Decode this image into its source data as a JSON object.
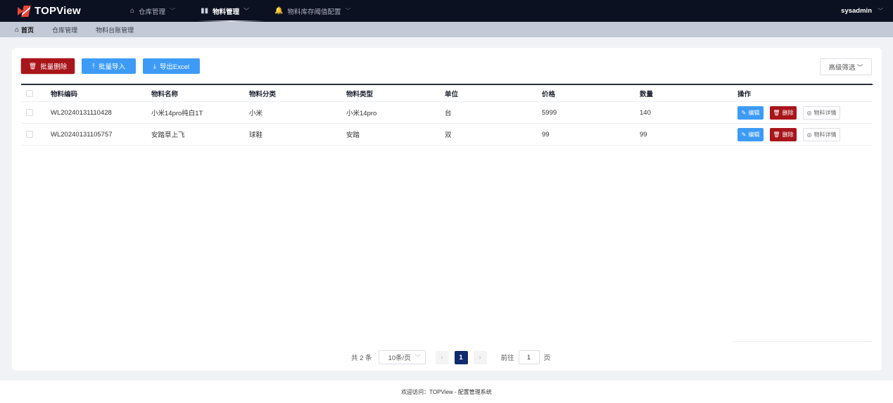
{
  "app": {
    "brand": "TOPView"
  },
  "nav": [
    {
      "label": "仓库管理",
      "icon": "home-icon",
      "active": false
    },
    {
      "label": "物料管理",
      "icon": "bar-chart-icon",
      "active": true
    },
    {
      "label": "物料库存阈值配置",
      "icon": "bell-icon",
      "active": false
    }
  ],
  "user": {
    "name": "sysadmin"
  },
  "breadcrumbs": [
    "首页",
    "仓库管理",
    "物料台账管理"
  ],
  "toolbar": {
    "batch_delete": "批量删除",
    "batch_import": "批量导入",
    "export_excel": "导出Excel",
    "advanced_filter": "高级筛选"
  },
  "table": {
    "headers": [
      "物料编码",
      "物料名称",
      "物料分类",
      "物料类型",
      "单位",
      "价格",
      "数量",
      "操作"
    ],
    "rows": [
      {
        "code": "WL20240131110428",
        "name": "小米14pro纯白1T",
        "category": "小米",
        "type": "小米14pro",
        "unit": "台",
        "price": "5999",
        "qty": "140"
      },
      {
        "code": "WL20240131105757",
        "name": "安踏草上飞",
        "category": "球鞋",
        "type": "安踏",
        "unit": "双",
        "price": "99",
        "qty": "99"
      }
    ],
    "actions": {
      "edit": "编辑",
      "delete": "删除",
      "detail": "物料详情"
    }
  },
  "pagination": {
    "total": "共 2 条",
    "page_size": "10条/页",
    "current": "1",
    "goto_prefix": "前往",
    "goto_value": "1",
    "goto_suffix": "页"
  },
  "footer": {
    "text": "欢迎访问：TOPView - 配置管理系统"
  },
  "colors": {
    "navbar": "#0b1120",
    "primary": "#3d9bf6",
    "danger": "#a8151a",
    "page_active": "#0d2b6e"
  }
}
